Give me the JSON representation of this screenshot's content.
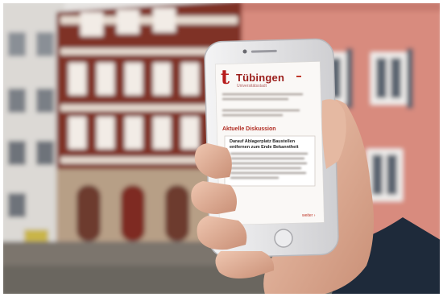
{
  "scene": {
    "description_colors": {
      "sky": "#e8e8ea",
      "building_left": "#d9d6d2",
      "building_center": "#8c3a2c",
      "building_right": "#d98c80",
      "ground": "#7a746c",
      "phone_body": "#e9e9ea",
      "screen": "#faf8f6",
      "skin": "#e2b7a0",
      "sleeve": "#1e2a3a",
      "accent": "#b71c1c"
    }
  },
  "app": {
    "logo_letter": "t",
    "title": "Tübingen",
    "subtitle": "Universitätsstadt",
    "section_heading": "Aktuelle Diskussion",
    "card_heading": "Darauf Ablagerplatz Baustellen entfernen zum Ende Bekanntheit",
    "more_link": "weiter  ›"
  }
}
